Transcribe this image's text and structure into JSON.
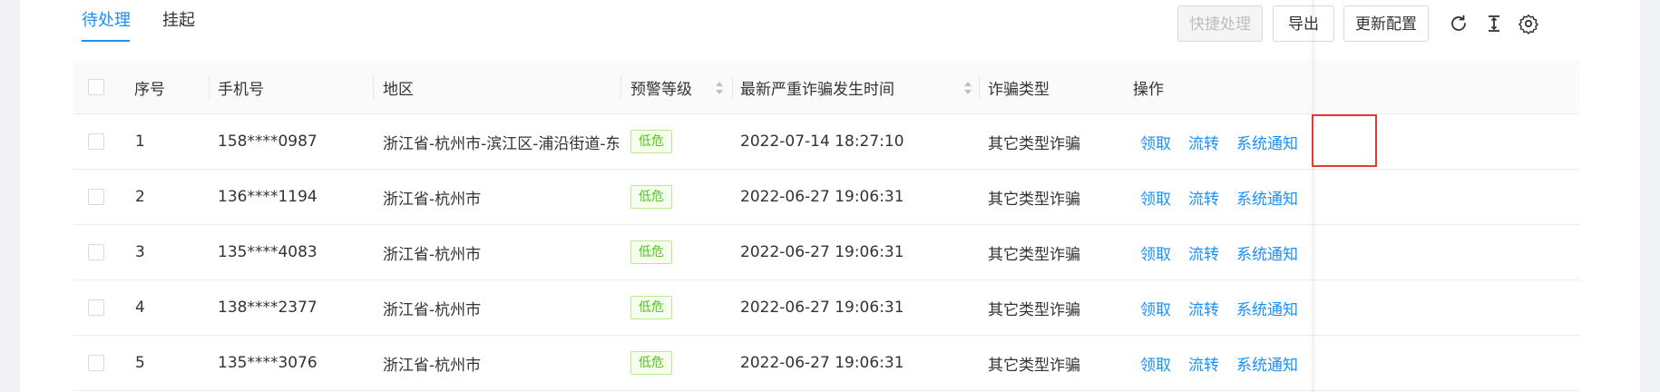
{
  "tabs": [
    {
      "label": "待处理",
      "active": true
    },
    {
      "label": "挂起",
      "active": false
    }
  ],
  "toolbar": {
    "quick_label": "快捷处理",
    "export_label": "导出",
    "update_label": "更新配置",
    "icons": [
      "refresh-icon",
      "column-height-icon",
      "setting-icon"
    ]
  },
  "table": {
    "columns": [
      "序号",
      "手机号",
      "地区",
      "预警等级",
      "最新严重诈骗发生时间",
      "诈骗类型",
      "操作"
    ],
    "rows": [
      {
        "index": "1",
        "phone": "158****0987",
        "region": "浙江省-杭州市-滨江区-浦沿街道-东...",
        "level": "低危",
        "time": "2022-07-14 18:27:10",
        "type": "其它类型诈骗"
      },
      {
        "index": "2",
        "phone": "136****1194",
        "region": "浙江省-杭州市",
        "level": "低危",
        "time": "2022-06-27 19:06:31",
        "type": "其它类型诈骗"
      },
      {
        "index": "3",
        "phone": "135****4083",
        "region": "浙江省-杭州市",
        "level": "低危",
        "time": "2022-06-27 19:06:31",
        "type": "其它类型诈骗"
      },
      {
        "index": "4",
        "phone": "138****2377",
        "region": "浙江省-杭州市",
        "level": "低危",
        "time": "2022-06-27 19:06:31",
        "type": "其它类型诈骗"
      },
      {
        "index": "5",
        "phone": "135****3076",
        "region": "浙江省-杭州市",
        "level": "低危",
        "time": "2022-06-27 19:06:31",
        "type": "其它类型诈骗"
      }
    ],
    "actions": {
      "claim": "领取",
      "transfer": "流转",
      "notify": "系统通知"
    }
  },
  "colors": {
    "accent": "#1890ff",
    "tag_green": "#52c41a",
    "highlight_red": "#e53935"
  }
}
